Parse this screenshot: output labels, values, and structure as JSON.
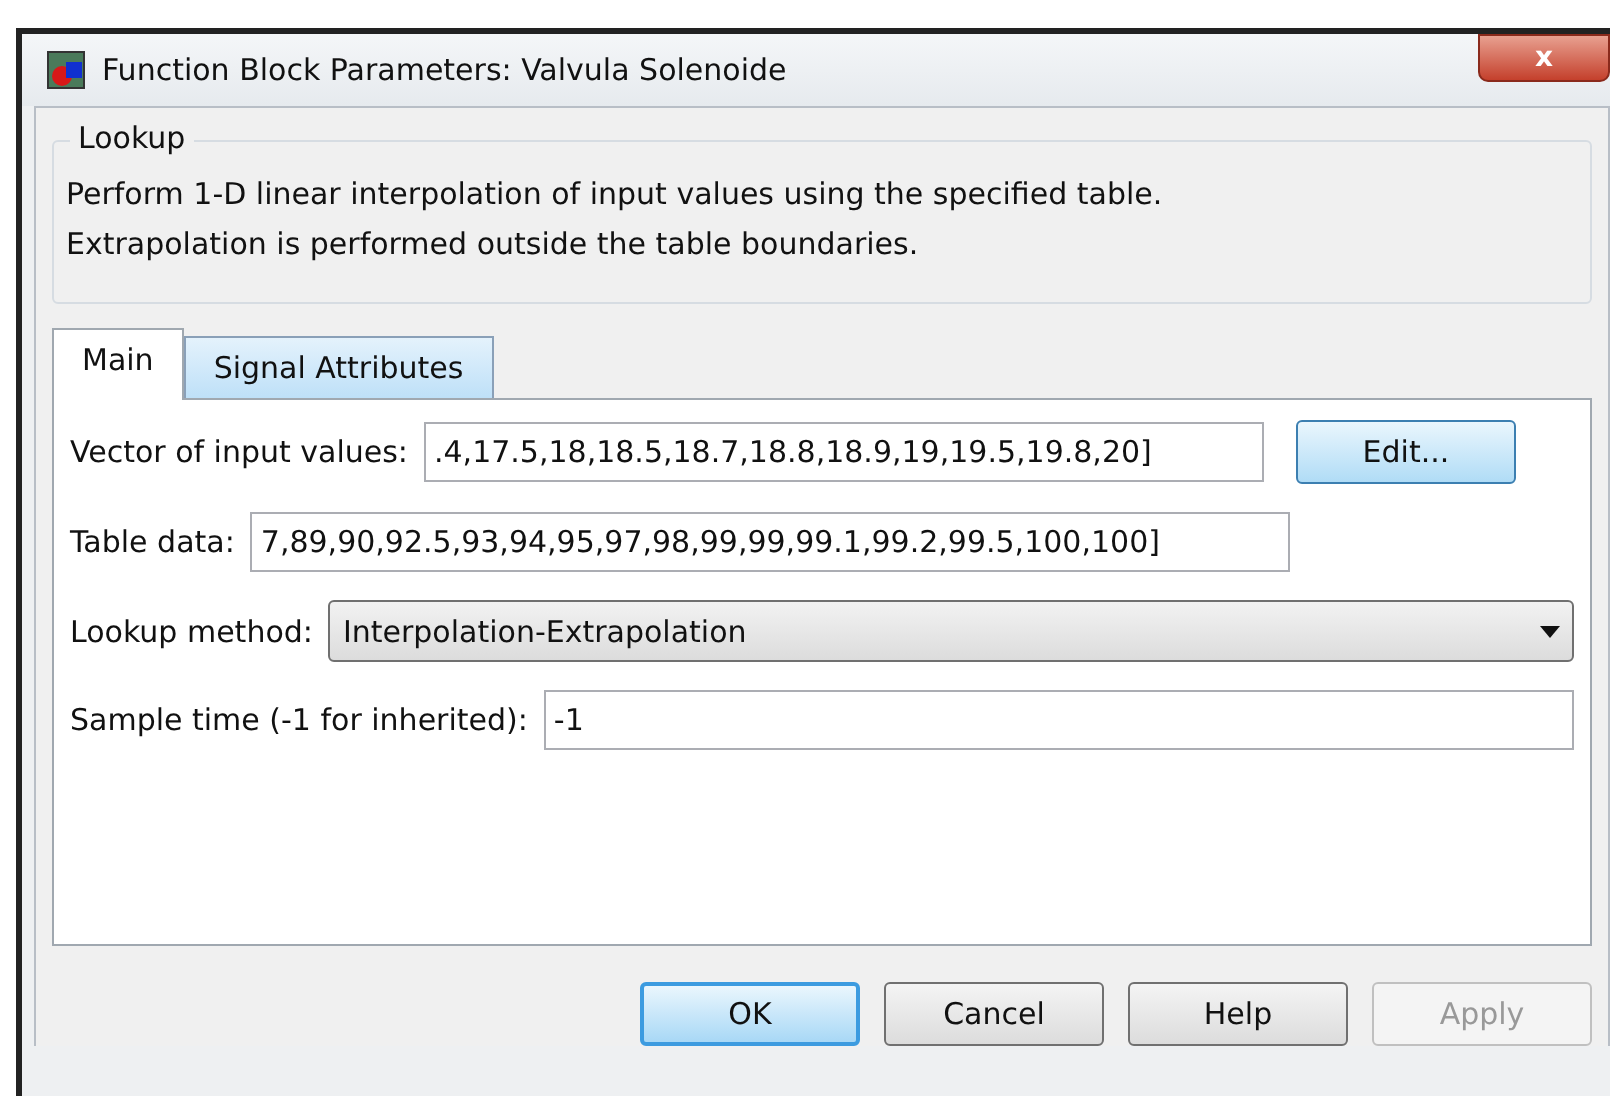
{
  "window": {
    "title": "Function Block Parameters: Valvula Solenoide",
    "close": "x"
  },
  "group": {
    "title": "Lookup",
    "description": "Perform 1-D linear interpolation of input values using the specified table.\nExtrapolation is performed outside the table boundaries."
  },
  "tabs": [
    {
      "label": "Main",
      "selected": true
    },
    {
      "label": "Signal Attributes",
      "selected": false
    }
  ],
  "fields": [
    {
      "kind": "text",
      "label": "Vector of input values:",
      "value": ".4,17.5,18,18.5,18.7,18.8,18.9,19,19.5,19.8,20]",
      "button": "Edit..."
    },
    {
      "kind": "text",
      "label": "Table data:",
      "value": "7,89,90,92.5,93,94,95,97,98,99,99,99.1,99.2,99.5,100,100]"
    },
    {
      "kind": "dropdown",
      "label": "Lookup method:",
      "value": "Interpolation-Extrapolation"
    },
    {
      "kind": "text",
      "label": "Sample time (-1 for inherited):",
      "value": "-1"
    }
  ],
  "buttons": [
    {
      "label": "OK",
      "default": true,
      "disabled": false
    },
    {
      "label": "Cancel",
      "default": false,
      "disabled": false
    },
    {
      "label": "Help",
      "default": false,
      "disabled": false
    },
    {
      "label": "Apply",
      "default": false,
      "disabled": true
    }
  ]
}
